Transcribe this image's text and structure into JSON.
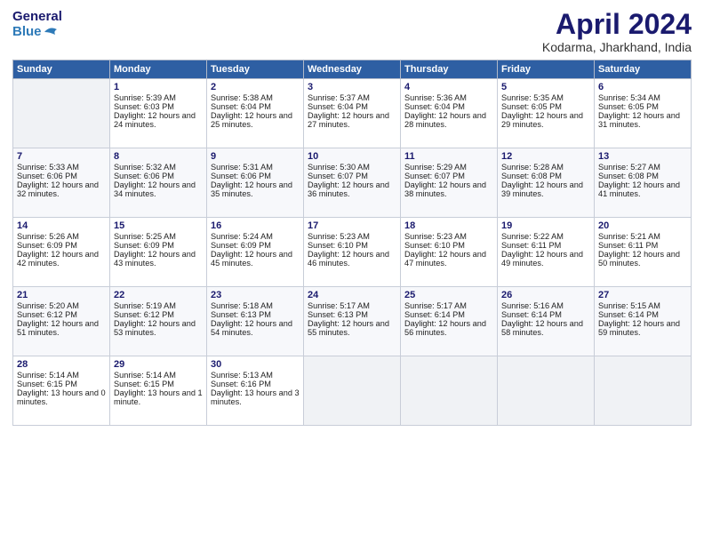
{
  "logo": {
    "line1": "General",
    "line2": "Blue"
  },
  "title": "April 2024",
  "location": "Kodarma, Jharkhand, India",
  "headers": [
    "Sunday",
    "Monday",
    "Tuesday",
    "Wednesday",
    "Thursday",
    "Friday",
    "Saturday"
  ],
  "weeks": [
    [
      {
        "day": "",
        "sunrise": "",
        "sunset": "",
        "daylight": "",
        "empty": true
      },
      {
        "day": "1",
        "sunrise": "Sunrise: 5:39 AM",
        "sunset": "Sunset: 6:03 PM",
        "daylight": "Daylight: 12 hours and 24 minutes.",
        "empty": false
      },
      {
        "day": "2",
        "sunrise": "Sunrise: 5:38 AM",
        "sunset": "Sunset: 6:04 PM",
        "daylight": "Daylight: 12 hours and 25 minutes.",
        "empty": false
      },
      {
        "day": "3",
        "sunrise": "Sunrise: 5:37 AM",
        "sunset": "Sunset: 6:04 PM",
        "daylight": "Daylight: 12 hours and 27 minutes.",
        "empty": false
      },
      {
        "day": "4",
        "sunrise": "Sunrise: 5:36 AM",
        "sunset": "Sunset: 6:04 PM",
        "daylight": "Daylight: 12 hours and 28 minutes.",
        "empty": false
      },
      {
        "day": "5",
        "sunrise": "Sunrise: 5:35 AM",
        "sunset": "Sunset: 6:05 PM",
        "daylight": "Daylight: 12 hours and 29 minutes.",
        "empty": false
      },
      {
        "day": "6",
        "sunrise": "Sunrise: 5:34 AM",
        "sunset": "Sunset: 6:05 PM",
        "daylight": "Daylight: 12 hours and 31 minutes.",
        "empty": false
      }
    ],
    [
      {
        "day": "7",
        "sunrise": "Sunrise: 5:33 AM",
        "sunset": "Sunset: 6:06 PM",
        "daylight": "Daylight: 12 hours and 32 minutes.",
        "empty": false
      },
      {
        "day": "8",
        "sunrise": "Sunrise: 5:32 AM",
        "sunset": "Sunset: 6:06 PM",
        "daylight": "Daylight: 12 hours and 34 minutes.",
        "empty": false
      },
      {
        "day": "9",
        "sunrise": "Sunrise: 5:31 AM",
        "sunset": "Sunset: 6:06 PM",
        "daylight": "Daylight: 12 hours and 35 minutes.",
        "empty": false
      },
      {
        "day": "10",
        "sunrise": "Sunrise: 5:30 AM",
        "sunset": "Sunset: 6:07 PM",
        "daylight": "Daylight: 12 hours and 36 minutes.",
        "empty": false
      },
      {
        "day": "11",
        "sunrise": "Sunrise: 5:29 AM",
        "sunset": "Sunset: 6:07 PM",
        "daylight": "Daylight: 12 hours and 38 minutes.",
        "empty": false
      },
      {
        "day": "12",
        "sunrise": "Sunrise: 5:28 AM",
        "sunset": "Sunset: 6:08 PM",
        "daylight": "Daylight: 12 hours and 39 minutes.",
        "empty": false
      },
      {
        "day": "13",
        "sunrise": "Sunrise: 5:27 AM",
        "sunset": "Sunset: 6:08 PM",
        "daylight": "Daylight: 12 hours and 41 minutes.",
        "empty": false
      }
    ],
    [
      {
        "day": "14",
        "sunrise": "Sunrise: 5:26 AM",
        "sunset": "Sunset: 6:09 PM",
        "daylight": "Daylight: 12 hours and 42 minutes.",
        "empty": false
      },
      {
        "day": "15",
        "sunrise": "Sunrise: 5:25 AM",
        "sunset": "Sunset: 6:09 PM",
        "daylight": "Daylight: 12 hours and 43 minutes.",
        "empty": false
      },
      {
        "day": "16",
        "sunrise": "Sunrise: 5:24 AM",
        "sunset": "Sunset: 6:09 PM",
        "daylight": "Daylight: 12 hours and 45 minutes.",
        "empty": false
      },
      {
        "day": "17",
        "sunrise": "Sunrise: 5:23 AM",
        "sunset": "Sunset: 6:10 PM",
        "daylight": "Daylight: 12 hours and 46 minutes.",
        "empty": false
      },
      {
        "day": "18",
        "sunrise": "Sunrise: 5:23 AM",
        "sunset": "Sunset: 6:10 PM",
        "daylight": "Daylight: 12 hours and 47 minutes.",
        "empty": false
      },
      {
        "day": "19",
        "sunrise": "Sunrise: 5:22 AM",
        "sunset": "Sunset: 6:11 PM",
        "daylight": "Daylight: 12 hours and 49 minutes.",
        "empty": false
      },
      {
        "day": "20",
        "sunrise": "Sunrise: 5:21 AM",
        "sunset": "Sunset: 6:11 PM",
        "daylight": "Daylight: 12 hours and 50 minutes.",
        "empty": false
      }
    ],
    [
      {
        "day": "21",
        "sunrise": "Sunrise: 5:20 AM",
        "sunset": "Sunset: 6:12 PM",
        "daylight": "Daylight: 12 hours and 51 minutes.",
        "empty": false
      },
      {
        "day": "22",
        "sunrise": "Sunrise: 5:19 AM",
        "sunset": "Sunset: 6:12 PM",
        "daylight": "Daylight: 12 hours and 53 minutes.",
        "empty": false
      },
      {
        "day": "23",
        "sunrise": "Sunrise: 5:18 AM",
        "sunset": "Sunset: 6:13 PM",
        "daylight": "Daylight: 12 hours and 54 minutes.",
        "empty": false
      },
      {
        "day": "24",
        "sunrise": "Sunrise: 5:17 AM",
        "sunset": "Sunset: 6:13 PM",
        "daylight": "Daylight: 12 hours and 55 minutes.",
        "empty": false
      },
      {
        "day": "25",
        "sunrise": "Sunrise: 5:17 AM",
        "sunset": "Sunset: 6:14 PM",
        "daylight": "Daylight: 12 hours and 56 minutes.",
        "empty": false
      },
      {
        "day": "26",
        "sunrise": "Sunrise: 5:16 AM",
        "sunset": "Sunset: 6:14 PM",
        "daylight": "Daylight: 12 hours and 58 minutes.",
        "empty": false
      },
      {
        "day": "27",
        "sunrise": "Sunrise: 5:15 AM",
        "sunset": "Sunset: 6:14 PM",
        "daylight": "Daylight: 12 hours and 59 minutes.",
        "empty": false
      }
    ],
    [
      {
        "day": "28",
        "sunrise": "Sunrise: 5:14 AM",
        "sunset": "Sunset: 6:15 PM",
        "daylight": "Daylight: 13 hours and 0 minutes.",
        "empty": false
      },
      {
        "day": "29",
        "sunrise": "Sunrise: 5:14 AM",
        "sunset": "Sunset: 6:15 PM",
        "daylight": "Daylight: 13 hours and 1 minute.",
        "empty": false
      },
      {
        "day": "30",
        "sunrise": "Sunrise: 5:13 AM",
        "sunset": "Sunset: 6:16 PM",
        "daylight": "Daylight: 13 hours and 3 minutes.",
        "empty": false
      },
      {
        "day": "",
        "sunrise": "",
        "sunset": "",
        "daylight": "",
        "empty": true
      },
      {
        "day": "",
        "sunrise": "",
        "sunset": "",
        "daylight": "",
        "empty": true
      },
      {
        "day": "",
        "sunrise": "",
        "sunset": "",
        "daylight": "",
        "empty": true
      },
      {
        "day": "",
        "sunrise": "",
        "sunset": "",
        "daylight": "",
        "empty": true
      }
    ]
  ]
}
